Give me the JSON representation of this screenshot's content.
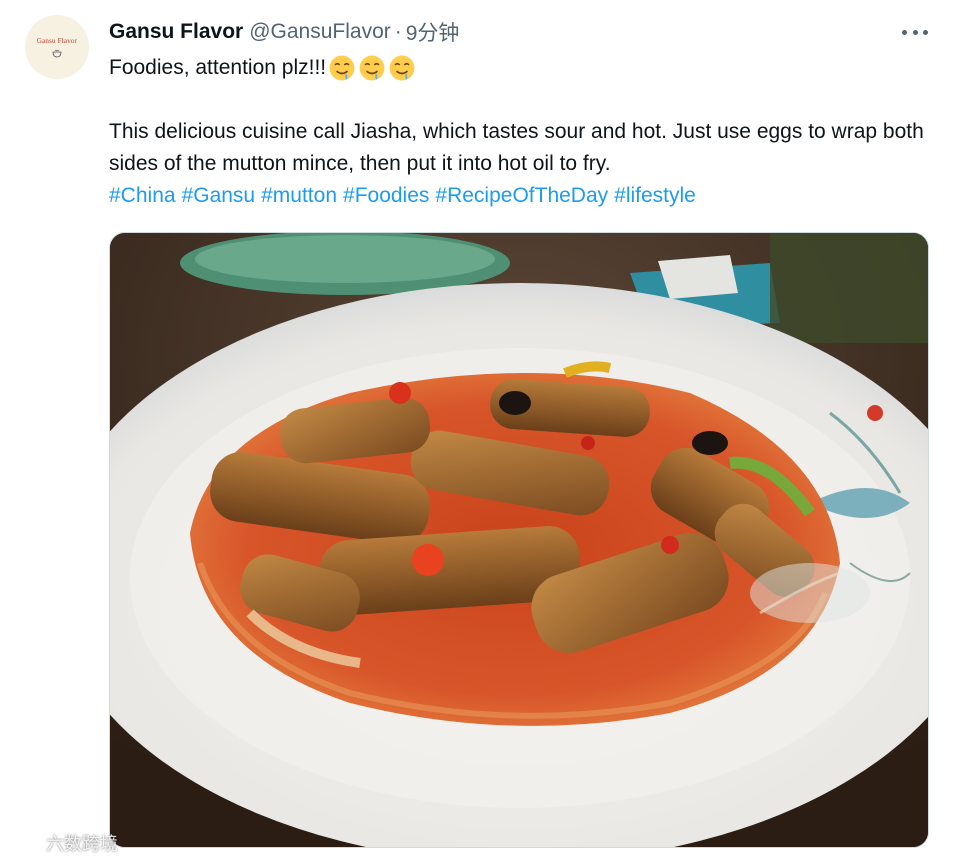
{
  "tweet": {
    "author": {
      "display_name": "Gansu Flavor",
      "handle": "@GansuFlavor",
      "avatar_text": "Gansu Flavor"
    },
    "separator": "·",
    "time": "9分钟",
    "more_icon": "more-horizontal-icon",
    "text_line1": "Foodies, attention plz!!!",
    "emoji": "drooling-face",
    "emoji_count": 3,
    "text_body": "This delicious cuisine call Jiasha, which tastes sour and hot. Just use eggs to wrap both sides of the mutton mince, then put it into hot oil to fry.",
    "hashtags": [
      "#China",
      "#Gansu",
      "#mutton",
      "#Foodies",
      "#RecipeOfTheDay",
      "#lifestyle"
    ],
    "colors": {
      "link": "#1d9bf0",
      "secondary_text": "#536471",
      "primary_text": "#0f1419"
    }
  },
  "watermark": {
    "text": "六数跨境"
  }
}
